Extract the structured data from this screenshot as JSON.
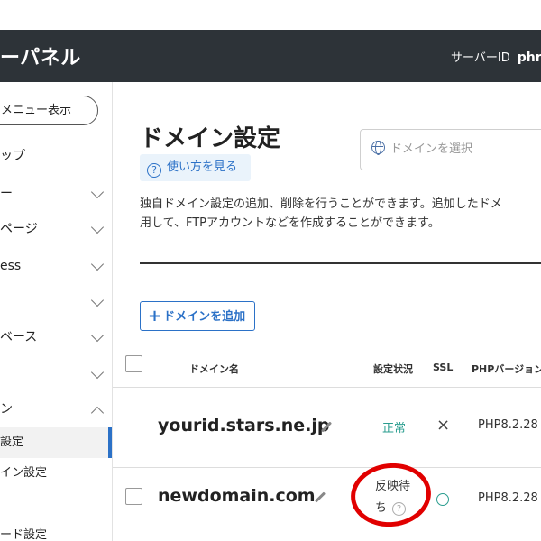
{
  "header": {
    "brand": "ーパネル",
    "server_label": "サーバーID",
    "server_id": "phri"
  },
  "sidebar": {
    "menu_toggle": "メニュー表示",
    "items": [
      {
        "label": "ップ",
        "chevron": "none"
      },
      {
        "label": "ー",
        "chevron": "down"
      },
      {
        "label": "ページ",
        "chevron": "down"
      },
      {
        "label": "ess",
        "chevron": "down"
      },
      {
        "label": "",
        "chevron": "down"
      },
      {
        "label": "ベース",
        "chevron": "down"
      },
      {
        "label": "",
        "chevron": "down"
      },
      {
        "label": "ン",
        "chevron": "up"
      }
    ],
    "subitems": [
      {
        "label": "設定",
        "active": true
      },
      {
        "label": "イン設定",
        "active": false
      },
      {
        "label": "ード設定",
        "active": false
      }
    ]
  },
  "main": {
    "title": "ドメイン設定",
    "howto": "使い方を見る",
    "domain_select_placeholder": "ドメインを選択",
    "description_line1": "独自ドメイン設定の追加、削除を行うことができます。追加したドメ",
    "description_line2": "用して、FTPアカウントなどを作成することができます。",
    "add_button": "ドメインを追加"
  },
  "table": {
    "headers": {
      "domain": "ドメイン名",
      "status": "設定状況",
      "ssl": "SSL",
      "php": "PHPバージョン"
    },
    "rows": [
      {
        "domain": "yourid.stars.ne.jp",
        "status": "正常",
        "ssl": "×",
        "php": "PHP8.2.28",
        "has_checkbox": false
      },
      {
        "domain": "newdomain.com",
        "status_line1": "反映待",
        "status_line2": "ち",
        "ssl": "○",
        "php": "PHP8.2.28",
        "has_checkbox": true
      }
    ]
  },
  "colors": {
    "header_bg": "#2d3338",
    "accent": "#2b71c7",
    "ok_green": "#2a9d8f",
    "annotation_red": "#e10000"
  }
}
